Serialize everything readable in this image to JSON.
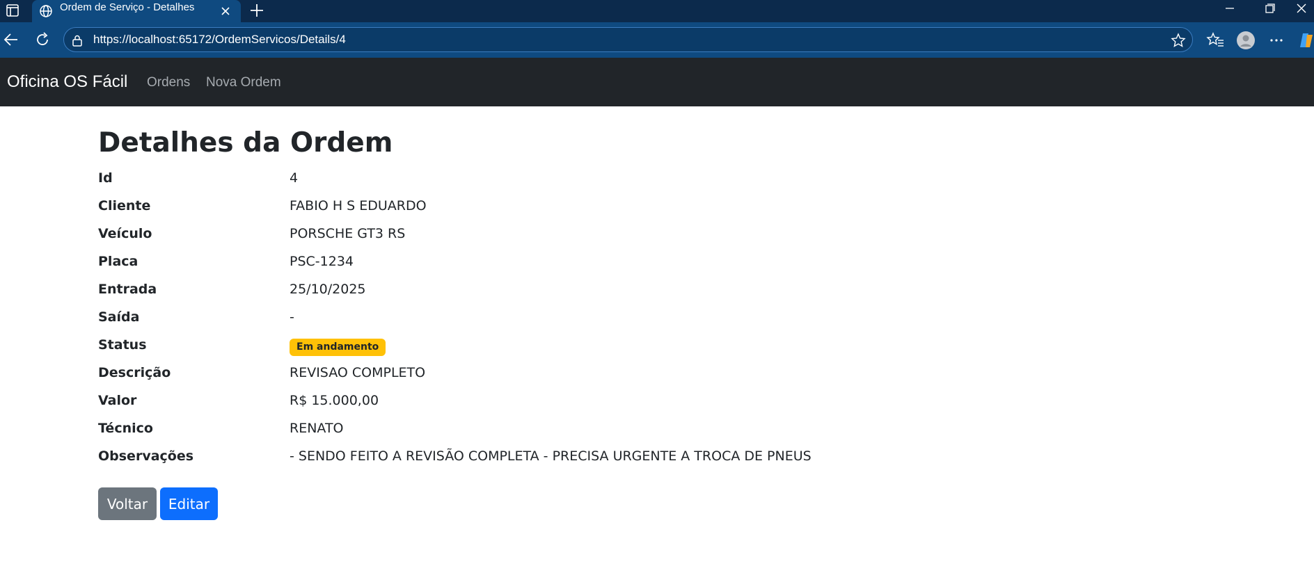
{
  "browser": {
    "tab_title": "Ordem de Serviço - Detalhes",
    "url": "https://localhost:65172/OrdemServicos/Details/4",
    "icons": [
      "tab-actions-icon",
      "globe-icon",
      "close-icon",
      "plus-icon",
      "minimize-icon",
      "restore-icon",
      "window-close-icon",
      "back-arrow-icon",
      "refresh-icon",
      "lock-icon",
      "star-icon",
      "favorites-icon",
      "profile-icon",
      "more-icon",
      "copilot-icon"
    ]
  },
  "navbar": {
    "brand": "Oficina OS Fácil",
    "links": [
      "Ordens",
      "Nova Ordem"
    ]
  },
  "page": {
    "title": "Detalhes da Ordem",
    "details": [
      {
        "label": "Id",
        "value": "4"
      },
      {
        "label": "Cliente",
        "value": "FABIO H S EDUARDO"
      },
      {
        "label": "Veículo",
        "value": "PORSCHE GT3 RS"
      },
      {
        "label": "Placa",
        "value": "PSC-1234"
      },
      {
        "label": "Entrada",
        "value": "25/10/2025"
      },
      {
        "label": "Saída",
        "value": "-"
      },
      {
        "label": "Status",
        "value": "Em andamento"
      },
      {
        "label": "Descrição",
        "value": "REVISAO COMPLETO"
      },
      {
        "label": "Valor",
        "value": "R$ 15.000,00"
      },
      {
        "label": "Técnico",
        "value": "RENATO"
      },
      {
        "label": "Observações",
        "value": "- SENDO FEITO A REVISÃO COMPLETA - PRECISA URGENTE A TROCA DE PNEUS"
      }
    ],
    "buttons": {
      "back": "Voltar",
      "edit": "Editar"
    }
  },
  "colors": {
    "status_badge": "#ffc107",
    "btn_back": "#6c757d",
    "btn_edit": "#0d6efd",
    "navbar_bg": "#212529"
  }
}
